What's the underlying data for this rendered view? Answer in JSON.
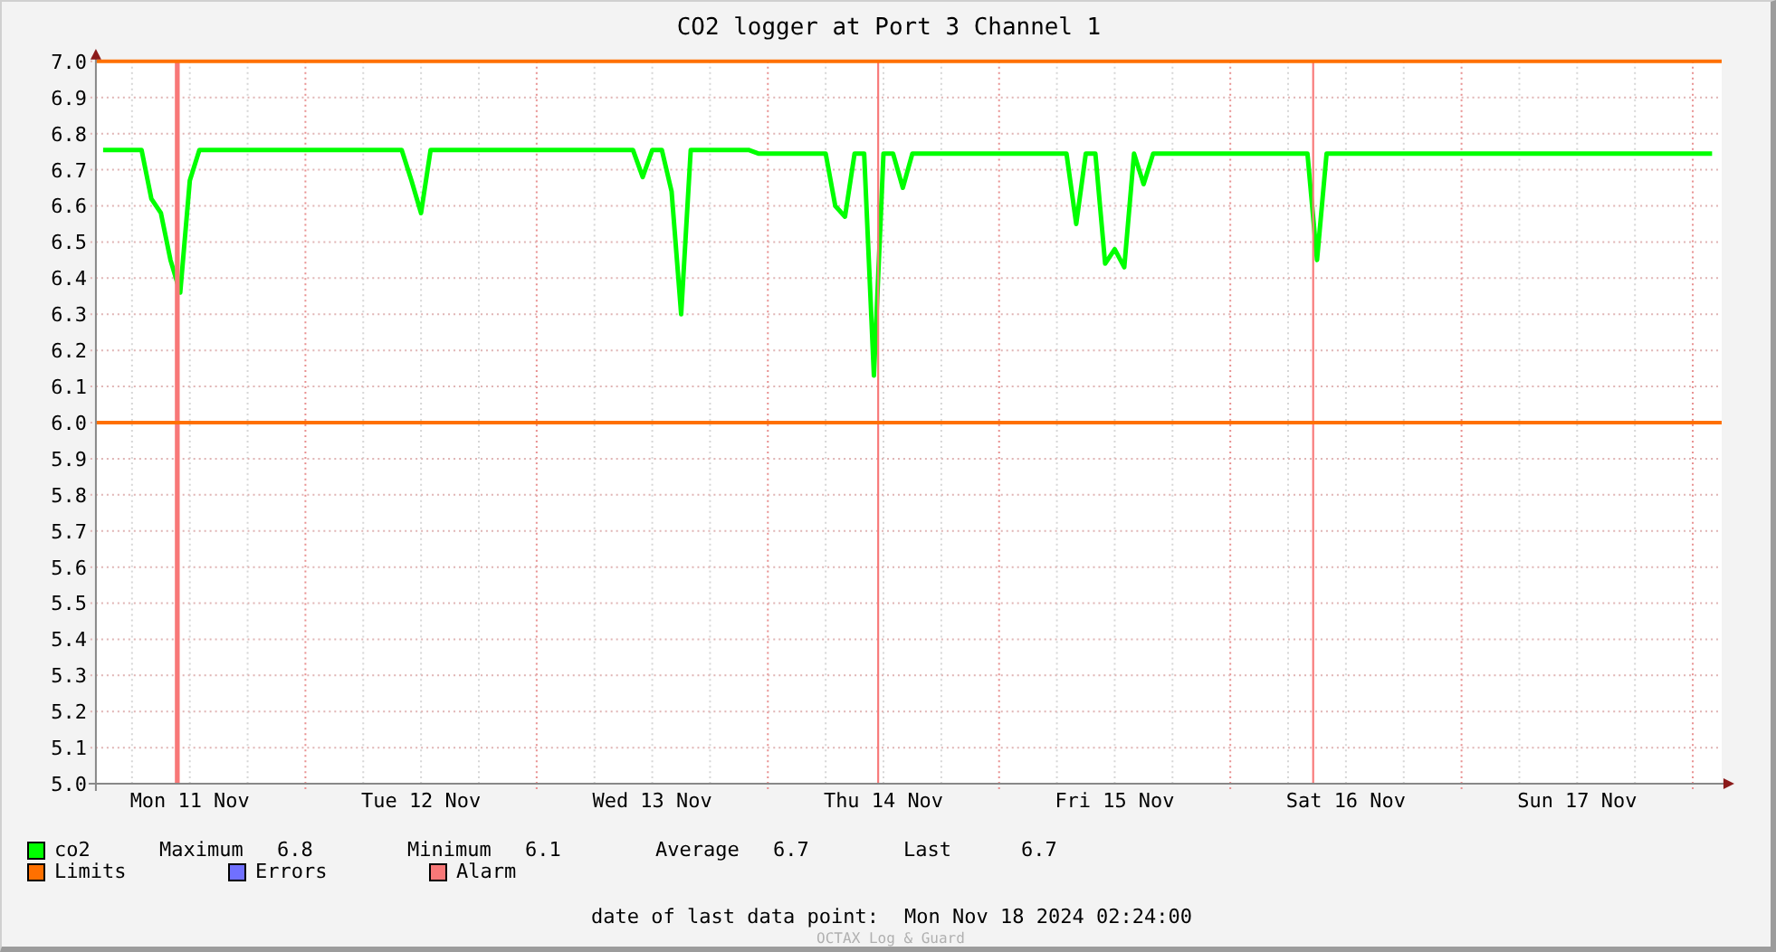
{
  "chart_data": {
    "type": "line",
    "title": "CO2 logger at Port 3 Channel 1",
    "categories": [
      null,
      null,
      null,
      null,
      null,
      null,
      null,
      null,
      null,
      "Mon 11 Nov",
      null,
      null,
      null,
      null,
      null,
      null,
      null,
      null,
      null,
      null,
      null,
      null,
      null,
      null,
      null,
      null,
      null,
      null,
      null,
      null,
      null,
      null,
      null,
      "Tue 12 Nov",
      null,
      null,
      null,
      null,
      null,
      null,
      null,
      null,
      null,
      null,
      null,
      null,
      null,
      null,
      null,
      null,
      null,
      null,
      null,
      null,
      null,
      null,
      null,
      "Wed 13 Nov",
      null,
      null,
      null,
      null,
      null,
      null,
      null,
      null,
      null,
      null,
      null,
      null,
      null,
      null,
      null,
      null,
      null,
      null,
      null,
      null,
      null,
      null,
      null,
      "Thu 14 Nov",
      null,
      null,
      null,
      null,
      null,
      null,
      null,
      null,
      null,
      null,
      null,
      null,
      null,
      null,
      null,
      null,
      null,
      null,
      null,
      null,
      null,
      null,
      null,
      "Fri 15 Nov",
      null,
      null,
      null,
      null,
      null,
      null,
      null,
      null,
      null,
      null,
      null,
      null,
      null,
      null,
      null,
      null,
      null,
      null,
      null,
      null,
      null,
      null,
      null,
      "Sat 16 Nov",
      null,
      null,
      null,
      null,
      null,
      null,
      null,
      null,
      null,
      null,
      null,
      null,
      null,
      null,
      null,
      null,
      null,
      null,
      null,
      null,
      null,
      null,
      null,
      "Sun 17 Nov",
      null,
      null,
      null,
      null,
      null,
      null,
      null,
      null,
      null,
      null,
      null,
      null,
      null,
      null
    ],
    "series": [
      {
        "name": "co2",
        "color": "#00ff00",
        "values": [
          6.755,
          6.755,
          6.755,
          6.755,
          6.755,
          6.62,
          6.58,
          6.45,
          6.36,
          6.67,
          6.755,
          6.755,
          6.755,
          6.755,
          6.755,
          6.755,
          6.755,
          6.755,
          6.755,
          6.755,
          6.755,
          6.755,
          6.755,
          6.755,
          6.755,
          6.755,
          6.755,
          6.755,
          6.755,
          6.755,
          6.755,
          6.755,
          6.67,
          6.58,
          6.755,
          6.755,
          6.755,
          6.755,
          6.755,
          6.755,
          6.755,
          6.755,
          6.755,
          6.755,
          6.755,
          6.755,
          6.755,
          6.755,
          6.755,
          6.755,
          6.755,
          6.755,
          6.755,
          6.755,
          6.755,
          6.755,
          6.68,
          6.755,
          6.755,
          6.64,
          6.3,
          6.755,
          6.755,
          6.755,
          6.755,
          6.755,
          6.755,
          6.755,
          6.745,
          6.745,
          6.745,
          6.745,
          6.745,
          6.745,
          6.745,
          6.745,
          6.6,
          6.57,
          6.745,
          6.745,
          6.13,
          6.745,
          6.745,
          6.65,
          6.745,
          6.745,
          6.745,
          6.745,
          6.745,
          6.745,
          6.745,
          6.745,
          6.745,
          6.745,
          6.745,
          6.745,
          6.745,
          6.745,
          6.745,
          6.745,
          6.745,
          6.55,
          6.745,
          6.745,
          6.44,
          6.48,
          6.43,
          6.745,
          6.66,
          6.745,
          6.745,
          6.745,
          6.745,
          6.745,
          6.745,
          6.745,
          6.745,
          6.745,
          6.745,
          6.745,
          6.745,
          6.745,
          6.745,
          6.745,
          6.745,
          6.745,
          6.45,
          6.745,
          6.745,
          6.745,
          6.745,
          6.745,
          6.745,
          6.745,
          6.745,
          6.745,
          6.745,
          6.745,
          6.745,
          6.745,
          6.745,
          6.745,
          6.745,
          6.745,
          6.745,
          6.745,
          6.745,
          6.745,
          6.745,
          6.745,
          6.745,
          6.745,
          6.745,
          6.745,
          6.745,
          6.745,
          6.745,
          6.745,
          6.745,
          6.745,
          6.745,
          6.745,
          6.745,
          6.745,
          6.745,
          6.745,
          6.745,
          6.745
        ]
      }
    ],
    "ylim": [
      5,
      7
    ],
    "grid": true,
    "yticks": [
      {
        "value": 5.0,
        "label": "5.0"
      },
      {
        "value": 5.1,
        "label": "5.1"
      },
      {
        "value": 5.2,
        "label": "5.2"
      },
      {
        "value": 5.3,
        "label": "5.3"
      },
      {
        "value": 5.4,
        "label": "5.4"
      },
      {
        "value": 5.5,
        "label": "5.5"
      },
      {
        "value": 5.6,
        "label": "5.6"
      },
      {
        "value": 5.7,
        "label": "5.7"
      },
      {
        "value": 5.8,
        "label": "5.8"
      },
      {
        "value": 5.9,
        "label": "5.9"
      },
      {
        "value": 6.0,
        "label": "6.0"
      },
      {
        "value": 6.1,
        "label": "6.1"
      },
      {
        "value": 6.2,
        "label": "6.2"
      },
      {
        "value": 6.3,
        "label": "6.3"
      },
      {
        "value": 6.4,
        "label": "6.4"
      },
      {
        "value": 6.5,
        "label": "6.5"
      },
      {
        "value": 6.6,
        "label": "6.6"
      },
      {
        "value": 6.7,
        "label": "6.7"
      },
      {
        "value": 6.8,
        "label": "6.8"
      },
      {
        "value": 6.9,
        "label": "6.9"
      },
      {
        "value": 7.0,
        "label": "7.0"
      }
    ],
    "ref_lines": [
      {
        "axis": "y",
        "value": 7.0
      },
      {
        "axis": "y",
        "value": 6.0
      }
    ]
  },
  "legend": [
    {
      "stats": [
        {
          "label": "Maximum",
          "value": "6.8"
        },
        {
          "label": "Minimum",
          "value": "6.1"
        },
        {
          "label": "Average",
          "value": "6.7"
        },
        {
          "label": "Last",
          "value": "6.7"
        }
      ]
    },
    {
      "label": "Limits",
      "color": "#ff7000"
    },
    {
      "label": "Errors",
      "color": "#7070ff"
    },
    {
      "label": "Alarm",
      "color": "#f87878"
    }
  ],
  "footer": {
    "label": "date of last data point:",
    "value": "Mon Nov 18 2024 02:24:00"
  },
  "watermark": "OCTAX Log & Guard"
}
